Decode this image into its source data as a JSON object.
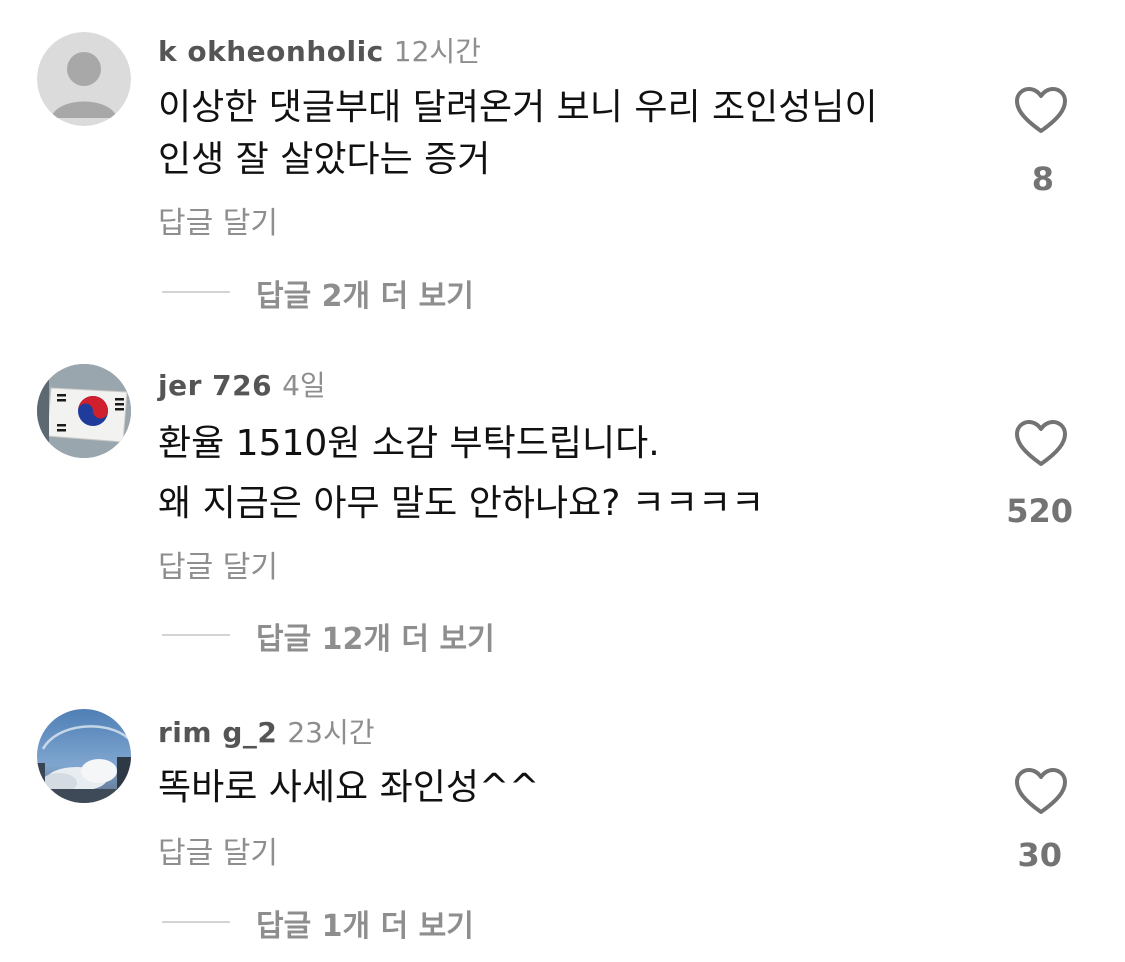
{
  "comments": [
    {
      "username": "k  okheonholic",
      "time": "12시간",
      "lines": [
        "이상한 댓글부대 달려온거 보니 우리 조인성님이",
        "인생 잘 살았다는 증거"
      ],
      "reply_label": "답글 달기",
      "more_replies": "답글 2개 더 보기",
      "likes": "8",
      "avatar_icon": "default-profile-icon"
    },
    {
      "username": "jer    726",
      "time": "4일",
      "lines": [
        "환율 1510원 소감 부탁드립니다.",
        "왜 지금은 아무 말도 안하나요? ㅋㅋㅋㅋ"
      ],
      "reply_label": "답글 달기",
      "more_replies": "답글 12개 더 보기",
      "likes": "520",
      "avatar_icon": "korean-flag-icon"
    },
    {
      "username": "rim    g_2",
      "time": "23시간",
      "lines": [
        "똑바로 사세요 좌인성^^"
      ],
      "reply_label": "답글 달기",
      "more_replies": "답글 1개 더 보기",
      "likes": "30",
      "avatar_icon": "sky-clouds-icon"
    }
  ],
  "colors": {
    "secondary_text": "#8e8e8e",
    "primary_text": "#111111",
    "divider": "#d4d4d4"
  }
}
